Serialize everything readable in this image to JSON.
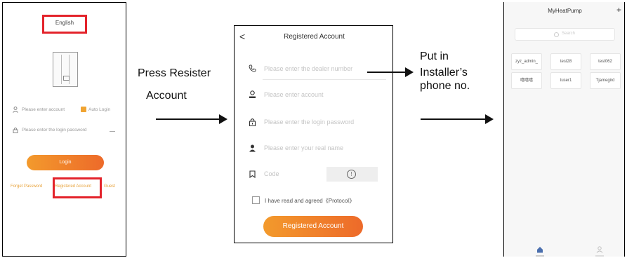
{
  "captions": {
    "press_register": "Press Resister",
    "account": "Account",
    "put_in": "Put in",
    "installers": "Installer’s",
    "phone_no": "phone no."
  },
  "login_screen": {
    "language": "English",
    "account_placeholder": "Please enter account",
    "auto_login": "Auto Login",
    "password_placeholder": "Please enter the login password",
    "login_button": "Login",
    "forget_password": "Forget Password",
    "registered_account": "Registered Account",
    "guest": "Guest"
  },
  "register_screen": {
    "back": "<",
    "title": "Registered Account",
    "dealer_placeholder": "Please enter the dealer number",
    "account_placeholder": "Please enter account",
    "password_placeholder": "Please enter the login password",
    "realname_placeholder": "Please enter your real name",
    "code_placeholder": "Code",
    "agreement": "I have read and agreed《Protocol》",
    "submit_button": "Registered Account"
  },
  "home_screen": {
    "title": "MyHeatPump",
    "add": "+",
    "search_placeholder": "Search",
    "devices": [
      "zyz_admin_",
      "test28",
      "test062",
      "嘻嘻嘻",
      "tuser1",
      "Tjamegird"
    ]
  },
  "colors": {
    "highlight": "#e3232b",
    "accent": "#ef7d2b",
    "link": "#e8a33c"
  }
}
